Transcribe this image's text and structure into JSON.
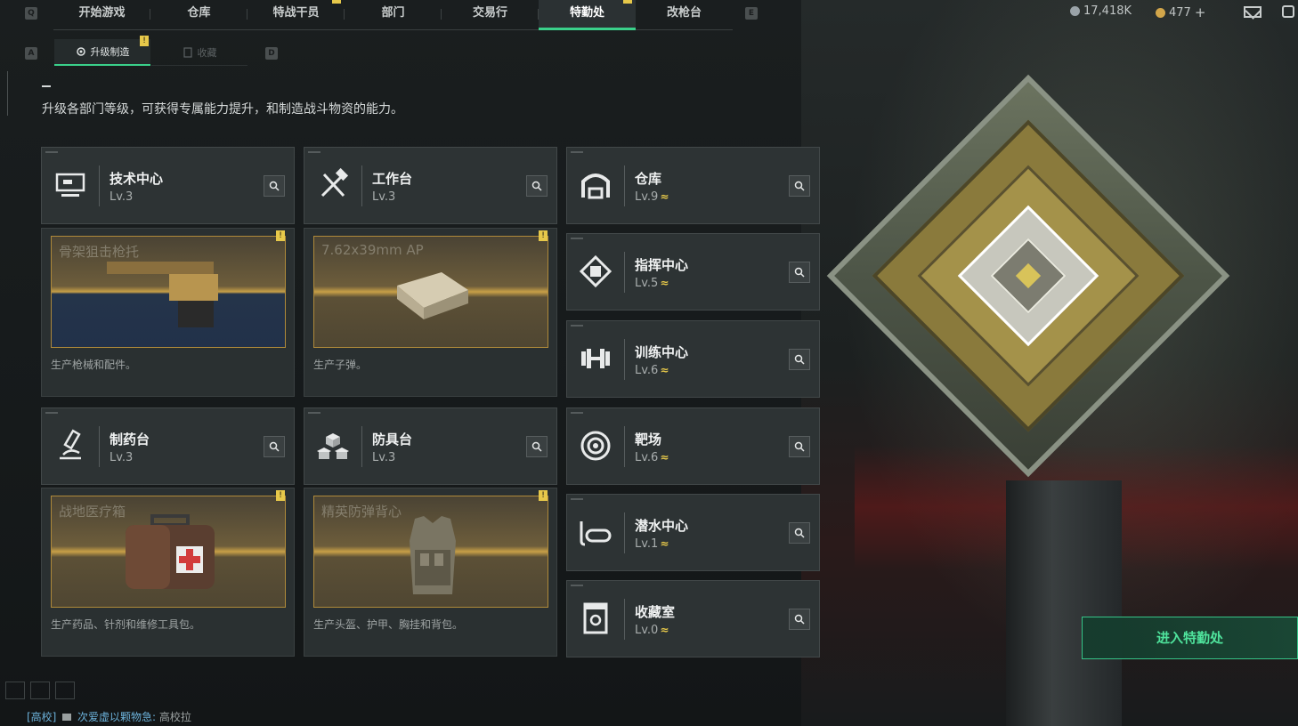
{
  "nav": {
    "left_key": "Q",
    "right_key": "E",
    "tabs": [
      {
        "label": "开始游戏",
        "active": false,
        "badge": false
      },
      {
        "label": "仓库",
        "active": false,
        "badge": false
      },
      {
        "label": "特战干员",
        "active": false,
        "badge": true
      },
      {
        "label": "部门",
        "active": false,
        "badge": false
      },
      {
        "label": "交易行",
        "active": false,
        "badge": false
      },
      {
        "label": "特勤处",
        "active": true,
        "badge": true
      },
      {
        "label": "改枪台",
        "active": false,
        "badge": false
      }
    ]
  },
  "currency": {
    "silver": "17,418K",
    "gold": "477",
    "add": "+"
  },
  "subtabs": {
    "left_key": "A",
    "right_key": "D",
    "upgrade": "升级制造",
    "collect": "收藏",
    "badge": "!"
  },
  "description": "升级各部门等级，可获得专属能力提升，和制造战斗物资的能力。",
  "stations": {
    "tech": {
      "name": "技术中心",
      "level": "Lv.3",
      "product": "骨架狙击枪托",
      "desc": "生产枪械和配件。",
      "badge": "!"
    },
    "workbench": {
      "name": "工作台",
      "level": "Lv.3",
      "product": "7.62x39mm AP",
      "desc": "生产子弹。",
      "badge": "!"
    },
    "pharmacy": {
      "name": "制药台",
      "level": "Lv.3",
      "product": "战地医疗箱",
      "desc": "生产药品、针剂和维修工具包。",
      "badge": "!"
    },
    "armor": {
      "name": "防具台",
      "level": "Lv.3",
      "product": "精英防弹背心",
      "desc": "生产头盔、护甲、胸挂和背包。",
      "badge": "!"
    }
  },
  "departments": [
    {
      "name": "仓库",
      "level": "Lv.9",
      "icon": "warehouse-icon"
    },
    {
      "name": "指挥中心",
      "level": "Lv.5",
      "icon": "command-icon"
    },
    {
      "name": "训练中心",
      "level": "Lv.6",
      "icon": "dumbbell-icon"
    },
    {
      "name": "靶场",
      "level": "Lv.6",
      "icon": "target-icon"
    },
    {
      "name": "潜水中心",
      "level": "Lv.1",
      "icon": "diving-icon"
    },
    {
      "name": "收藏室",
      "level": "Lv.0",
      "icon": "collection-icon"
    }
  ],
  "level_up_glyph": "≈",
  "enter_button": "进入特勤处",
  "chat": {
    "channel": "[高校]",
    "sender": "次爱虚以颗物急:",
    "message": "高校拉"
  },
  "colors": {
    "accent_green": "#3ad08a",
    "badge_yellow": "#e6c84a",
    "panel_bg": "#2d3334"
  }
}
